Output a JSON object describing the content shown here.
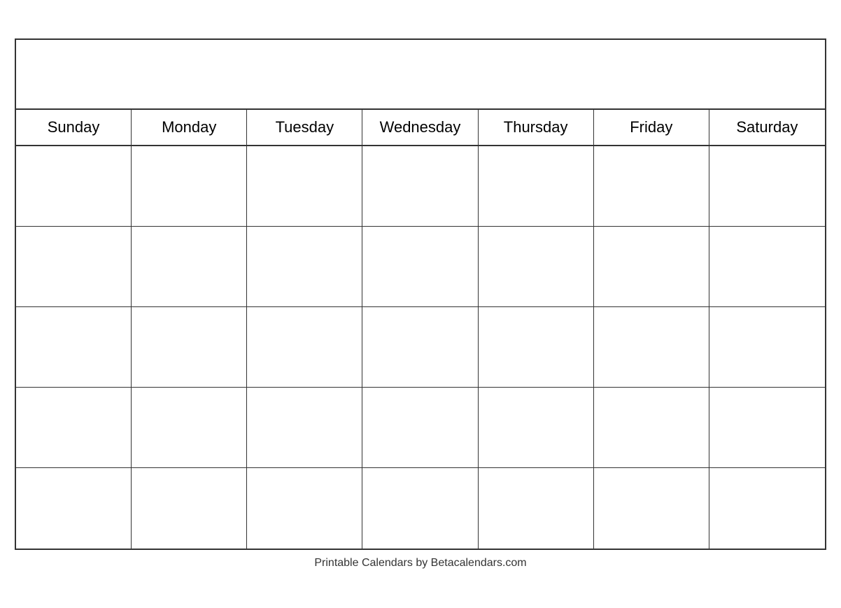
{
  "calendar": {
    "title": "",
    "days": [
      "Sunday",
      "Monday",
      "Tuesday",
      "Wednesday",
      "Thursday",
      "Friday",
      "Saturday"
    ],
    "rows": 5,
    "footer": "Printable Calendars by Betacalendars.com"
  }
}
